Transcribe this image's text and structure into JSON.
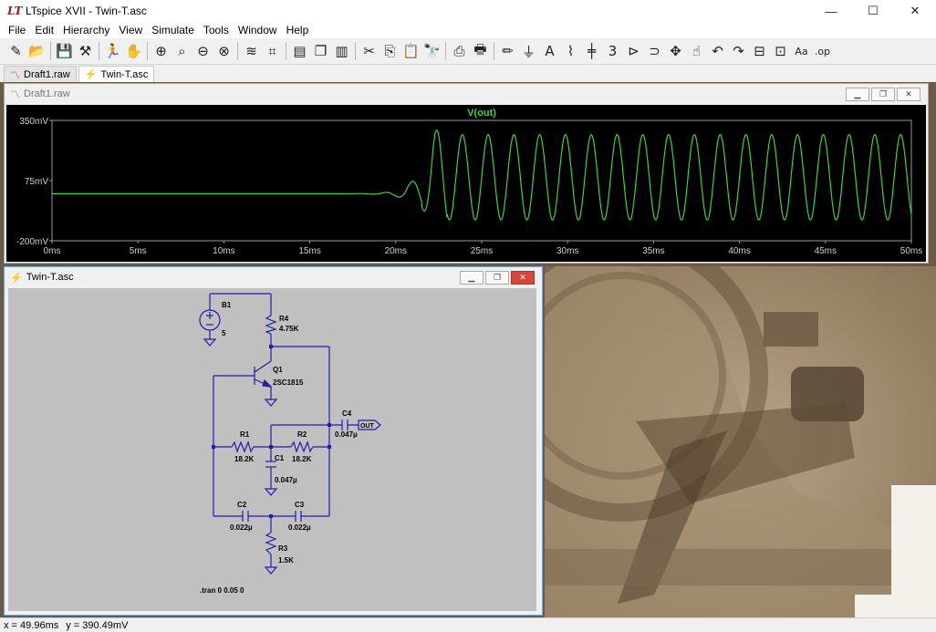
{
  "window": {
    "title": "LTspice XVII - Twin-T.asc",
    "minimize": "—",
    "maximize": "☐",
    "close": "✕"
  },
  "menu": [
    "File",
    "Edit",
    "Hierarchy",
    "View",
    "Simulate",
    "Tools",
    "Window",
    "Help"
  ],
  "toolbar": [
    {
      "icon": "new-schematic-icon",
      "glyph": "✎"
    },
    {
      "icon": "open-icon",
      "glyph": "📂"
    },
    {
      "sep": true
    },
    {
      "icon": "save-icon",
      "glyph": "💾"
    },
    {
      "icon": "control-panel-icon",
      "glyph": "⚒"
    },
    {
      "sep": true
    },
    {
      "icon": "run-icon",
      "glyph": "🏃"
    },
    {
      "icon": "halt-icon",
      "glyph": "✋"
    },
    {
      "sep": true
    },
    {
      "icon": "zoom-in-icon",
      "glyph": "⊕"
    },
    {
      "icon": "pan-icon",
      "glyph": "⌕"
    },
    {
      "icon": "zoom-out-icon",
      "glyph": "⊖"
    },
    {
      "icon": "zoom-fit-icon",
      "glyph": "⊗"
    },
    {
      "sep": true
    },
    {
      "icon": "autorange-icon",
      "glyph": "≋"
    },
    {
      "icon": "delete-trace-icon",
      "glyph": "⌗"
    },
    {
      "sep": true
    },
    {
      "icon": "tile-horizontal-icon",
      "glyph": "▤"
    },
    {
      "icon": "cascade-icon",
      "glyph": "❐"
    },
    {
      "icon": "tile-vertical-icon",
      "glyph": "▥"
    },
    {
      "sep": true
    },
    {
      "icon": "cut-icon",
      "glyph": "✂"
    },
    {
      "icon": "copy-icon",
      "glyph": "⎘"
    },
    {
      "icon": "paste-icon",
      "glyph": "📋"
    },
    {
      "icon": "find-icon",
      "glyph": "🔭"
    },
    {
      "sep": true
    },
    {
      "icon": "print-preview-icon",
      "glyph": "⎙"
    },
    {
      "icon": "print-icon",
      "glyph": "🖶"
    },
    {
      "sep": true
    },
    {
      "icon": "draw-wire-icon",
      "glyph": "✏"
    },
    {
      "icon": "ground-icon",
      "glyph": "⏚"
    },
    {
      "icon": "label-net-icon",
      "glyph": "A"
    },
    {
      "icon": "resistor-icon",
      "glyph": "⌇"
    },
    {
      "icon": "capacitor-icon",
      "glyph": "╪"
    },
    {
      "icon": "inductor-icon",
      "glyph": "3"
    },
    {
      "icon": "diode-icon",
      "glyph": "⊳"
    },
    {
      "icon": "component-icon",
      "glyph": "⊃"
    },
    {
      "icon": "move-icon",
      "glyph": "✥"
    },
    {
      "icon": "drag-icon",
      "glyph": "☝"
    },
    {
      "icon": "undo-icon",
      "glyph": "↶"
    },
    {
      "icon": "redo-icon",
      "glyph": "↷"
    },
    {
      "icon": "rotate-icon",
      "glyph": "⊟"
    },
    {
      "icon": "mirror-icon",
      "glyph": "⊡"
    },
    {
      "icon": "text-icon",
      "glyph": "Aa"
    },
    {
      "icon": "spice-directive-icon",
      "glyph": ".op"
    }
  ],
  "tabs": [
    {
      "label": "Draft1.raw",
      "icon": "waveform-icon",
      "active": false
    },
    {
      "label": "Twin-T.asc",
      "icon": "schematic-icon",
      "active": true
    }
  ],
  "waveform_window": {
    "title": "Draft1.raw",
    "trace_name": "V(out)",
    "trace_color": "#3fd13f"
  },
  "chart_data": {
    "type": "line",
    "title": "V(out)",
    "xlabel": "",
    "ylabel": "",
    "x_ticks": [
      "0ms",
      "5ms",
      "10ms",
      "15ms",
      "20ms",
      "25ms",
      "30ms",
      "35ms",
      "40ms",
      "45ms",
      "50ms"
    ],
    "y_ticks": [
      "350mV",
      "75mV",
      "-200mV"
    ],
    "xlim_ms": [
      0,
      50
    ],
    "ylim_mV": [
      -200,
      350
    ],
    "grid": false,
    "series": [
      {
        "name": "V(out)",
        "color": "#3fd13f",
        "description_points": [
          {
            "t_ms": 0,
            "mV": 15
          },
          {
            "t_ms": 15,
            "mV": 15
          },
          {
            "t_ms": 18,
            "mV": 18
          },
          {
            "t_ms": 20,
            "mV": 10
          },
          {
            "t_ms": 21,
            "mV": -150
          },
          {
            "t_ms": 22,
            "mV": 335
          },
          {
            "t_ms": 50,
            "mV": 300
          }
        ],
        "oscillation_start_ms": 16,
        "oscillation_period_ms": 1.5,
        "steady_amplitude_mV": 195,
        "steady_offset_mV": 90
      }
    ]
  },
  "schematic_window": {
    "title": "Twin-T.asc"
  },
  "schematic": {
    "B1": {
      "name": "B1",
      "value": "5"
    },
    "R4": {
      "name": "R4",
      "value": "4.75K"
    },
    "Q1": {
      "name": "Q1",
      "value": "2SC1815"
    },
    "C4": {
      "name": "C4",
      "value": "0.047µ"
    },
    "out_label": "OUT",
    "R1": {
      "name": "R1",
      "value": "18.2K"
    },
    "R2": {
      "name": "R2",
      "value": "18.2K"
    },
    "C1": {
      "name": "C1",
      "value": "0.047µ"
    },
    "C2": {
      "name": "C2",
      "value": "0.022µ"
    },
    "C3": {
      "name": "C3",
      "value": "0.022µ"
    },
    "R3": {
      "name": "R3",
      "value": "1.5K"
    },
    "directive": ".tran 0 0.05 0",
    "wire_color": "#1e1ea8"
  },
  "status": {
    "x": "x = 49.96ms",
    "y": "y = 390.49mV"
  }
}
